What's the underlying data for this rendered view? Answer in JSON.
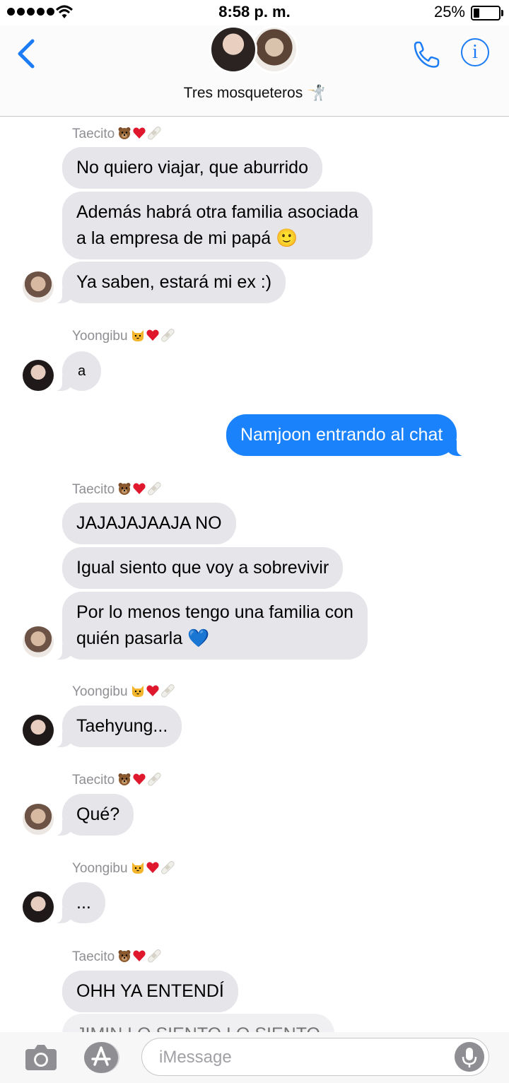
{
  "status_bar": {
    "time": "8:58 p. m.",
    "battery_percent": "25%",
    "battery_level": 0.25,
    "signal_bars": 5
  },
  "header": {
    "group_name": "Tres mosqueteros 🤺",
    "icons": [
      "back-chevron-icon",
      "phone-icon",
      "info-icon"
    ],
    "accent_color": "#1c7cf5"
  },
  "messages": [
    {
      "sender": "Taecito",
      "sender_emoji": [
        "bear",
        "red-heart",
        "bandage"
      ],
      "texts": [
        "No quiero viajar, que aburrido",
        "Además habrá otra familia asociada\na la empresa de mi papá 🙂",
        "Ya saben, estará mi ex :)"
      ]
    },
    {
      "sender": "Yoongibu",
      "sender_emoji": [
        "cat",
        "red-heart",
        "bandage"
      ],
      "texts": [
        "a"
      ]
    },
    {
      "outgoing": true,
      "texts": [
        "Namjoon entrando al chat"
      ]
    },
    {
      "sender": "Taecito",
      "sender_emoji": [
        "bear",
        "red-heart",
        "bandage"
      ],
      "texts": [
        "JAJAJAJAAJA NO",
        "Igual siento que voy a sobrevivir",
        "Por lo menos tengo una familia con\nquién pasarla 💙"
      ]
    },
    {
      "sender": "Yoongibu",
      "sender_emoji": [
        "cat",
        "red-heart",
        "bandage"
      ],
      "texts": [
        "Taehyung..."
      ]
    },
    {
      "sender": "Taecito",
      "sender_emoji": [
        "bear",
        "red-heart",
        "bandage"
      ],
      "texts": [
        "Qué?"
      ]
    },
    {
      "sender": "Yoongibu",
      "sender_emoji": [
        "cat",
        "red-heart",
        "bandage"
      ],
      "texts": [
        "..."
      ]
    },
    {
      "sender": "Taecito",
      "sender_emoji": [
        "bear",
        "red-heart",
        "bandage"
      ],
      "texts": [
        "OHH YA ENTENDÍ",
        "JIMIN LO SIENTO LO SIENTO"
      ]
    }
  ],
  "input_bar": {
    "placeholder": "iMessage",
    "icons": [
      "camera-icon",
      "app-store-icon",
      "microphone-icon"
    ]
  },
  "colors": {
    "incoming_bubble": "#e5e5ea",
    "outgoing_bubble": "#1a82fb",
    "sender_label": "#8e8e93"
  }
}
